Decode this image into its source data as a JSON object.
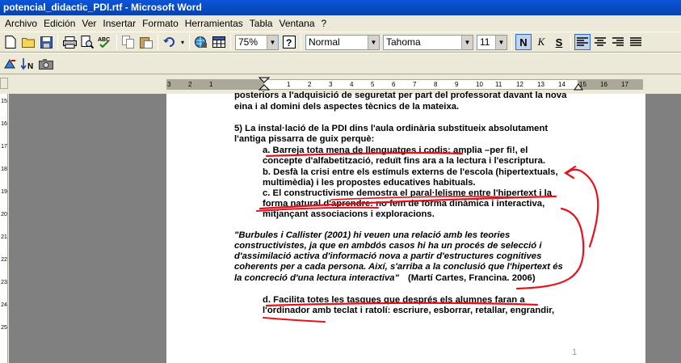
{
  "window": {
    "title": "potencial_didactic_PDI.rtf - Microsoft Word"
  },
  "menu": [
    "Archivo",
    "Edición",
    "Ver",
    "Insertar",
    "Formato",
    "Herramientas",
    "Tabla",
    "Ventana",
    "?"
  ],
  "toolbar": {
    "zoom": "75%",
    "style": "Normal",
    "font": "Tahoma",
    "size": "11",
    "bold_label": "N",
    "italic_label": "K",
    "underline_label": "S"
  },
  "ruler": {
    "numbers": [
      "3",
      "2",
      "1",
      "1",
      "2",
      "3",
      "4",
      "5",
      "6",
      "7",
      "8",
      "9",
      "10",
      "11",
      "12",
      "13",
      "14",
      "15",
      "16",
      "17"
    ],
    "vertical_numbers": [
      "15",
      "16",
      "17",
      "18",
      "19",
      "20",
      "21",
      "22",
      "23",
      "24",
      "25"
    ]
  },
  "document": {
    "lines": [
      "posteriors a l'adquisició de seguretat per part del professorat davant la nova",
      "eina i al domini dels aspectes tècnics de la mateixa.",
      "5) La instal·lació de la PDI dins l'aula ordinària substitueix absolutament",
      "l'antiga pissarra de guix perquè:",
      "a. Barreja tota mena de llenguatges i codis: amplia –per fi!, el",
      "concepte d'alfabetització, reduït fins ara a la lectura i l'escriptura.",
      "b. Desfà la crisi entre els estímuls externs de l'escola (hipertextuals,",
      "multimèdia) i les propostes educatives habituals.",
      "c. El constructivisme demostra el paral·lelisme entre l'hipertext i la",
      "forma natural d'aprendre: no fem de forma dinàmica i interactiva,",
      "mitjançant associacions i exploracions.",
      "\"Burbules i Callister (2001) hi veuen una relació amb les teories",
      "constructivistes, ja que en ambdós casos hi ha un procés de selecció i",
      "d'assimilació activa d'informació nova a partir d'estructures cognitives",
      "coherents per a cada persona. Així, s'arriba a la conclusió que l'hipertext és",
      "la concreció d'una lectura interactiva\"",
      "(Martí Cartes, Francina. 2006)",
      "d. Facilita totes les tasques que després els alumnes faran a",
      "l'ordinador amb teclat i ratolí: escriure, esborrar, retallar, engrandir,"
    ],
    "page_number": "1"
  },
  "colors": {
    "titlebar": "#0842b0",
    "annotation": "#e8111b",
    "workspace": "#808080"
  }
}
